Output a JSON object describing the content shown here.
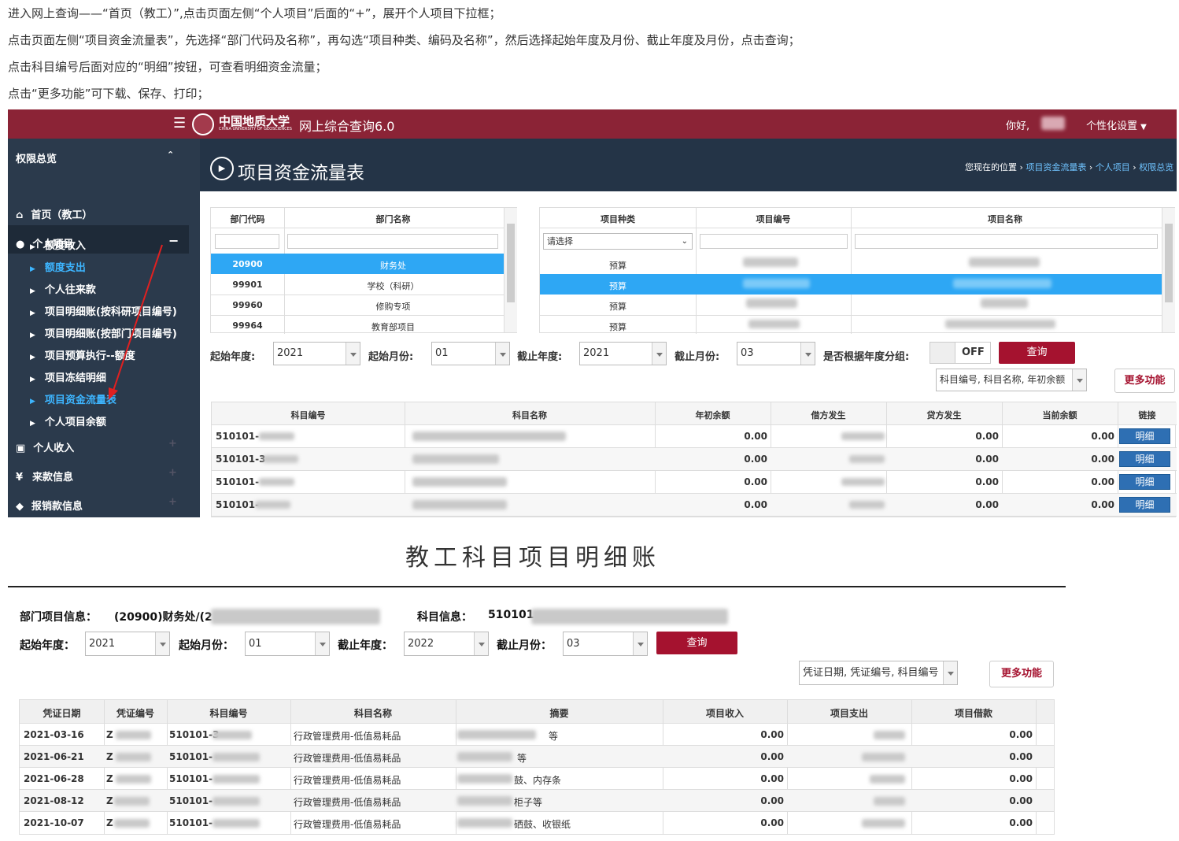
{
  "instructions": [
    "进入网上查询——“首页（教工）”,点击页面左侧“个人项目”后面的“+”，展开个人项目下拉框；",
    "点击页面左侧“项目资金流量表”，先选择“部门代码及名称”，再勾选“项目种类、编码及名称”，然后选择起始年度及月份、截止年度及月份，点击查询；",
    "点击科目编号后面对应的“明细”按钮，可查看明细资金流量；",
    "点击“更多功能”可下载、保存、打印；"
  ],
  "header": {
    "logo_text": "中国地质大学",
    "logo_sub": "CHINA UNIVERSITY OF GEOSCIENCES",
    "app_title": "网上综合查询6.0",
    "greeting": "你好,",
    "settings": "个性化设置"
  },
  "sidebar": {
    "top": "权限总览",
    "home": "首页（教工）",
    "personal_projects": "个人项目",
    "sub_items": [
      "额度收入",
      "额度支出",
      "个人往来款",
      "项目明细账(按科研项目编号)",
      "项目明细账(按部门项目编号)",
      "项目预算执行--额度",
      "项目冻结明细",
      "项目资金流量表",
      "个人项目余额"
    ],
    "personal_income": "个人收入",
    "incoming_info": "来款信息",
    "reimbursement": "报销款信息"
  },
  "page": {
    "title": "项目资金流量表",
    "breadcrumb_prefix": "您现在的位置",
    "breadcrumb": [
      "项目资金流量表",
      "个人项目",
      "权限总览"
    ]
  },
  "dept_table": {
    "headers": [
      "部门代码",
      "部门名称"
    ],
    "rows": [
      {
        "code": "20900",
        "name": "财务处"
      },
      {
        "code": "99901",
        "name": "学校（科研）"
      },
      {
        "code": "99960",
        "name": "修购专项"
      },
      {
        "code": "99964",
        "name": "教育部项目"
      }
    ]
  },
  "proj_table": {
    "headers": [
      "项目种类",
      "项目编号",
      "项目名称"
    ],
    "filter_placeholder": "请选择",
    "rows": [
      "预算",
      "预算",
      "预算",
      "预算"
    ]
  },
  "filters": {
    "start_year_label": "起始年度:",
    "start_year": "2021",
    "start_month_label": "起始月份:",
    "start_month": "01",
    "end_year_label": "截止年度:",
    "end_year": "2021",
    "end_month_label": "截止月份:",
    "end_month": "03",
    "group_label": "是否根据年度分组:",
    "toggle": "OFF",
    "query": "查询",
    "sort_select": "科目编号, 科目名称, 年初余额",
    "more": "更多功能"
  },
  "flow_table": {
    "headers": [
      "科目编号",
      "科目名称",
      "年初余额",
      "借方发生",
      "贷方发生",
      "当前余额",
      "链接"
    ],
    "rows": [
      {
        "code": "510101-",
        "open": "0.00",
        "credit": "0.00",
        "current": "0.00"
      },
      {
        "code": "510101-3",
        "open": "0.00",
        "credit": "0.00",
        "current": "0.00"
      },
      {
        "code": "510101-",
        "open": "0.00",
        "credit": "0.00",
        "current": "0.00"
      },
      {
        "code": "510101-",
        "open": "0.00",
        "credit": "0.00",
        "current": "0.00"
      }
    ],
    "detail_btn": "明细"
  },
  "ledger": {
    "title": "教工科目项目明细账",
    "dept_label": "部门项目信息：",
    "dept_value": "(20900)财务处/(2",
    "subject_label": "科目信息：",
    "subject_value": "510101",
    "start_year_label": "起始年度：",
    "start_year": "2021",
    "start_month_label": "起始月份：",
    "start_month": "01",
    "end_year_label": "截止年度：",
    "end_year": "2022",
    "end_month_label": "截止月份：",
    "end_month": "03",
    "query": "查询",
    "sort_select": "凭证日期, 凭证编号, 科目编号",
    "more": "更多功能",
    "headers": [
      "凭证日期",
      "凭证编号",
      "科目编号",
      "科目名称",
      "摘要",
      "项目收入",
      "项目支出",
      "项目借款"
    ],
    "rows": [
      {
        "date": "2021-03-16",
        "voucher": "Z",
        "code": "510101-3",
        "name": "行政管理费用-低值易耗品",
        "summary": "等",
        "income": "0.00",
        "loan": "0.00"
      },
      {
        "date": "2021-06-21",
        "voucher": "Z",
        "code": "510101-",
        "name": "行政管理费用-低值易耗品",
        "summary": "等",
        "income": "0.00",
        "loan": "0.00"
      },
      {
        "date": "2021-06-28",
        "voucher": "Z",
        "code": "510101-",
        "name": "行政管理费用-低值易耗品",
        "summary": "鼓、内存条",
        "income": "0.00",
        "loan": "0.00"
      },
      {
        "date": "2021-08-12",
        "voucher": "Z",
        "code": "510101-",
        "name": "行政管理费用-低值易耗品",
        "summary": "柜子等",
        "income": "0.00",
        "loan": "0.00"
      },
      {
        "date": "2021-10-07",
        "voucher": "Z",
        "code": "510101-",
        "name": "行政管理费用-低值易耗品",
        "summary": "硒鼓、收银纸",
        "income": "0.00",
        "loan": "0.00"
      }
    ]
  }
}
